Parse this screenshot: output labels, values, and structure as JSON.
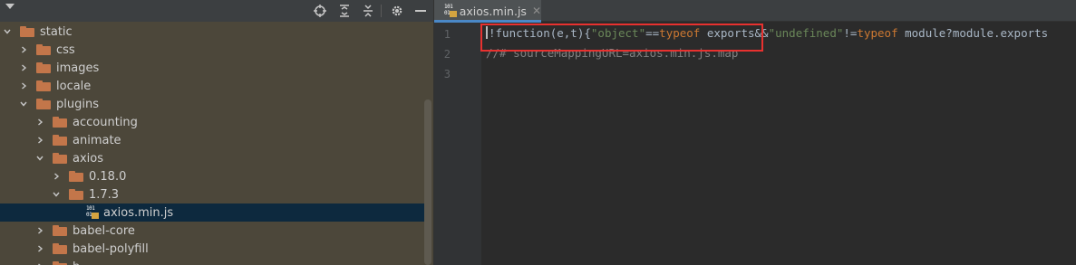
{
  "project_panel": {
    "toolbar": {
      "icons": [
        "dropdown-arrow-icon",
        "locate-target-icon",
        "expand-all-icon",
        "collapse-all-icon",
        "gear-icon",
        "minimize-icon"
      ]
    },
    "tree": [
      {
        "label": "static",
        "type": "folder",
        "expanded": true,
        "depth": 0
      },
      {
        "label": "css",
        "type": "folder",
        "expanded": false,
        "depth": 1
      },
      {
        "label": "images",
        "type": "folder",
        "expanded": false,
        "depth": 1
      },
      {
        "label": "locale",
        "type": "folder",
        "expanded": false,
        "depth": 1
      },
      {
        "label": "plugins",
        "type": "folder",
        "expanded": true,
        "depth": 1
      },
      {
        "label": "accounting",
        "type": "folder",
        "expanded": false,
        "depth": 2
      },
      {
        "label": "animate",
        "type": "folder",
        "expanded": false,
        "depth": 2
      },
      {
        "label": "axios",
        "type": "folder",
        "expanded": true,
        "depth": 2
      },
      {
        "label": "0.18.0",
        "type": "folder",
        "expanded": false,
        "depth": 3
      },
      {
        "label": "1.7.3",
        "type": "folder",
        "expanded": true,
        "depth": 3
      },
      {
        "label": "axios.min.js",
        "type": "file",
        "selected": true,
        "depth": 4
      },
      {
        "label": "babel-core",
        "type": "folder",
        "expanded": false,
        "depth": 2
      },
      {
        "label": "babel-polyfill",
        "type": "folder",
        "expanded": false,
        "depth": 2
      },
      {
        "label": "b",
        "type": "folder",
        "expanded": false,
        "depth": 2
      }
    ]
  },
  "editor": {
    "tab": {
      "label": "axios.min.js",
      "icon_top": "101",
      "icon_bottom": "01"
    },
    "line_numbers": [
      "1",
      "2",
      "3"
    ],
    "lines": [
      [
        {
          "t": "plain",
          "v": "!function(e,t){"
        },
        {
          "t": "str",
          "v": "\"object\""
        },
        {
          "t": "plain",
          "v": "=="
        },
        {
          "t": "kw",
          "v": "typeof"
        },
        {
          "t": "plain",
          "v": " exports&&"
        },
        {
          "t": "str",
          "v": "\"undefined\""
        },
        {
          "t": "plain",
          "v": "!="
        },
        {
          "t": "kw",
          "v": "typeof"
        },
        {
          "t": "plain",
          "v": " module?module.exports"
        }
      ],
      [
        {
          "t": "com",
          "v": "//# sourceMappingURL=axios.min.js.map"
        }
      ],
      []
    ],
    "highlight_color": "#e8312f"
  },
  "colors": {
    "panel_bg": "#4c473a",
    "editor_bg": "#2b2b2b",
    "selection": "#0d293e",
    "folder": "#c3764a",
    "keyword": "#cc7832",
    "string": "#6a8759",
    "comment": "#808080"
  }
}
